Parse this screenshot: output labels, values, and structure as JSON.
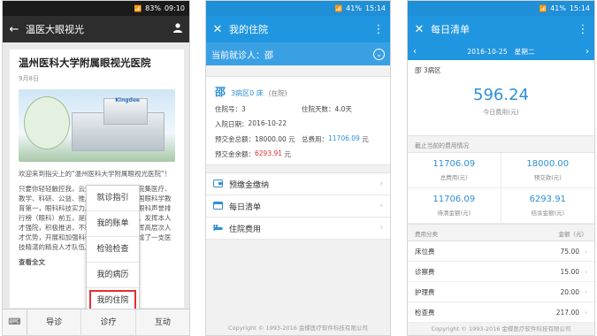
{
  "phone1": {
    "status": {
      "battery": "83%",
      "time": "09:10"
    },
    "title": "温医大眼视光",
    "article": {
      "title": "温州医科大学附属眼视光医院",
      "date": "9月8日",
      "image_label": "Kingdee",
      "paragraph1": "欢迎来到指尖上的\"温州医科大学附属眼视光医院\"！",
      "paragraph2": "只要你轻轻触控我，云流水般的服务。医院集医疗、教学、科研、公益、推广为一体，位于中国眼科学教育第一，眼科科技实力居全国前列，位于眼科声誉排行榜（眼科）前五，是国家眼科科研平台。发挥本人才强院，积极推进，不断提高新平台，发挥高层次人才优势，开展和加强科研和引进力度，形成了一支医技精湛的精良人才队伍。",
      "more": "查看全文"
    },
    "menu": [
      "就诊指引",
      "我的账单",
      "检验检查",
      "我的病历",
      "我的住院"
    ],
    "bottom_tabs": [
      "导诊",
      "诊疗",
      "互动"
    ]
  },
  "phone2": {
    "status": {
      "battery": "41%",
      "time": "15:14"
    },
    "title": "我的住院",
    "patient_label": "当前就诊人：邵",
    "info": {
      "name": "邵",
      "ward": "3病区0 床",
      "status": "(在院)",
      "admission_no_label": "住院号：3",
      "days_label": "住院天数：",
      "days_value": "4.0天",
      "date_label": "入院日期：",
      "date_value": "2016-10-22",
      "deposit_total_label": "预交金总额：",
      "deposit_total_value": "18000.00 元",
      "total_cost_label": "总费用：",
      "total_cost_value": "11706.09",
      "total_cost_unit": "元",
      "balance_label": "预交金余额：",
      "balance_value": "6293.91",
      "balance_unit": "元"
    },
    "links": [
      {
        "icon": "wallet-icon",
        "label": "预缴金缴纳"
      },
      {
        "icon": "calendar-icon",
        "label": "每日清单"
      },
      {
        "icon": "bed-icon",
        "label": "住院费用"
      }
    ],
    "copyright": "Copyright © 1993-2016 金蝶医疗软件科技有限公司"
  },
  "phone3": {
    "status": {
      "battery": "41%",
      "time": "15:14"
    },
    "title": "每日清单",
    "date": "2016-10-25",
    "weekday": "星期二",
    "ward": "邵   3病区",
    "today_cost": "596.24",
    "today_cost_label": "今日费用(元)",
    "section_label": "截止当前的费用情况",
    "stats": [
      {
        "value": "11706.09",
        "label": "总费用(元)"
      },
      {
        "value": "18000.00",
        "label": "预交款(元)"
      },
      {
        "value": "11706.09",
        "label": "待清金额(元)"
      },
      {
        "value": "6293.91",
        "label": "结余金额(元)"
      }
    ],
    "cat_header": {
      "left": "费用分类",
      "right": "金额（元）"
    },
    "categories": [
      {
        "name": "床位费",
        "amount": "75.00"
      },
      {
        "name": "诊察费",
        "amount": "15.00"
      },
      {
        "name": "护理费",
        "amount": "20.00"
      },
      {
        "name": "检查费",
        "amount": "217.00"
      }
    ],
    "copyright": "Copyright © 1993-2016 金蝶医疗软件科技有限公司"
  }
}
